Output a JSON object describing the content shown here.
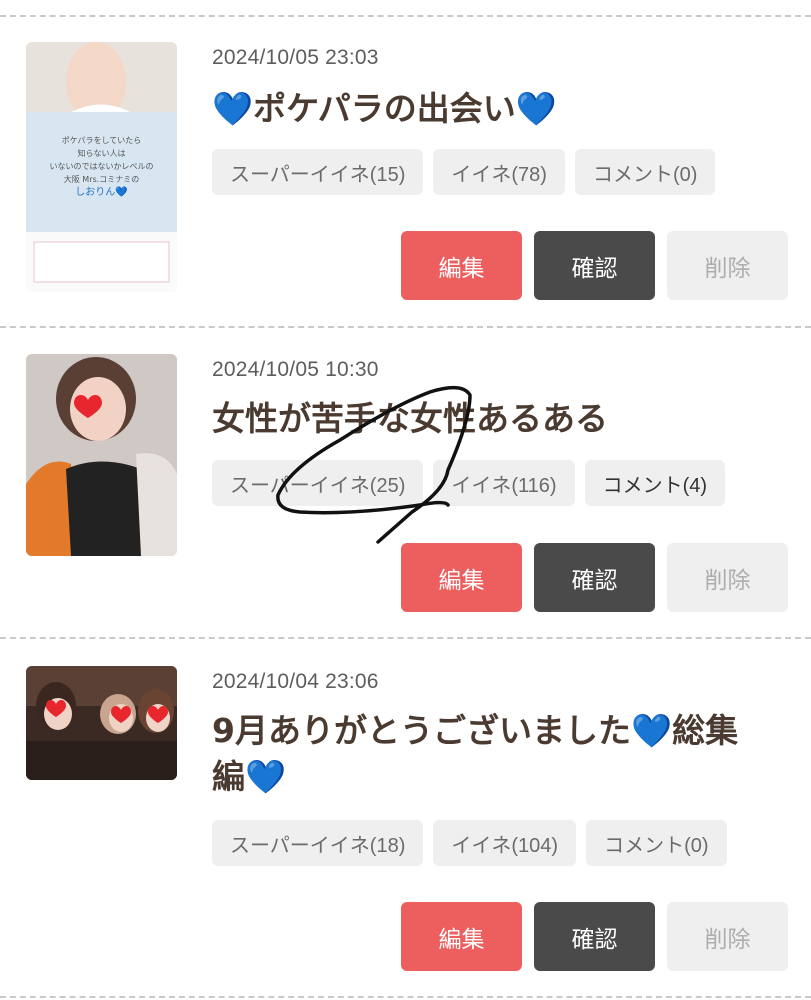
{
  "posts": [
    {
      "date": "2024/10/05 23:03",
      "title_parts": [
        "💙",
        "ポケパラの出会い",
        "💙"
      ],
      "stats": {
        "super_like": "スーパーイイネ(15)",
        "like": "イイネ(78)",
        "comment": "コメント(0)"
      },
      "thumb_text": {
        "line1": "ポケパラをしていたら",
        "line2": "知らない人は",
        "line3": "いないのではないかレベルの",
        "line4": "大阪 Mrs.コミナミの",
        "line5": "しおりん💙"
      }
    },
    {
      "date": "2024/10/05 10:30",
      "title": "女性が苦手な女性あるある",
      "stats": {
        "super_like": "スーパーイイネ(25)",
        "like": "イイネ(116)",
        "comment": "コメント(4)"
      }
    },
    {
      "date": "2024/10/04 23:06",
      "title_line1": "9月ありがとうございました💙総集",
      "title_line2": "編💙",
      "stats": {
        "super_like": "スーパーイイネ(18)",
        "like": "イイネ(104)",
        "comment": "コメント(0)"
      }
    }
  ],
  "buttons": {
    "edit": "編集",
    "confirm": "確認",
    "delete": "削除"
  },
  "colors": {
    "edit": "#ec5f5e",
    "confirm": "#4a4a4a",
    "delete": "#efefef",
    "heart": "#1e7ad8"
  }
}
